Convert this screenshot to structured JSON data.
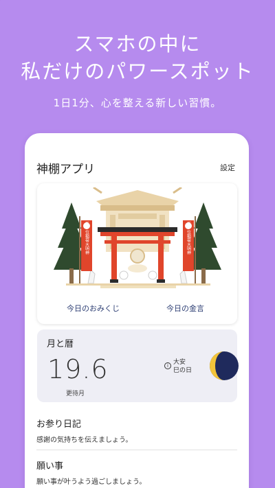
{
  "promo": {
    "headline_line1": "スマホの中に",
    "headline_line2": "私だけのパワースポット",
    "subtitle": "1日1分、心を整える新しい習慣。"
  },
  "app": {
    "title": "神棚アプリ",
    "settings_label": "設定"
  },
  "shrine_card": {
    "omikuji_label": "今日のおみくじ",
    "kingen_label": "今日の金言",
    "banner_text": "正一位稲荷大明神"
  },
  "moon_card": {
    "title": "月と暦",
    "moon_age": "19.6",
    "moon_phase_name": "更待月",
    "info_symbol": "i",
    "rokuyo_line1": "大安",
    "rokuyo_line2": "巳の日"
  },
  "list": [
    {
      "title": "お参り日記",
      "desc": "感謝の気持ちを伝えましょう。"
    },
    {
      "title": "願い事",
      "desc": "願い事が叶うよう過ごしましょう。"
    }
  ],
  "colors": {
    "background": "#b68bee",
    "card_bg": "#ffffff",
    "moon_card_bg": "#eeeef5",
    "torii_red": "#e0452b",
    "link_color": "#2d3e73",
    "moon_yellow": "#f2c43a",
    "moon_navy": "#1f2a5c"
  },
  "icons": {
    "info": "info-icon",
    "moon": "moon-phase-icon",
    "shrine": "shrine-illustration"
  }
}
